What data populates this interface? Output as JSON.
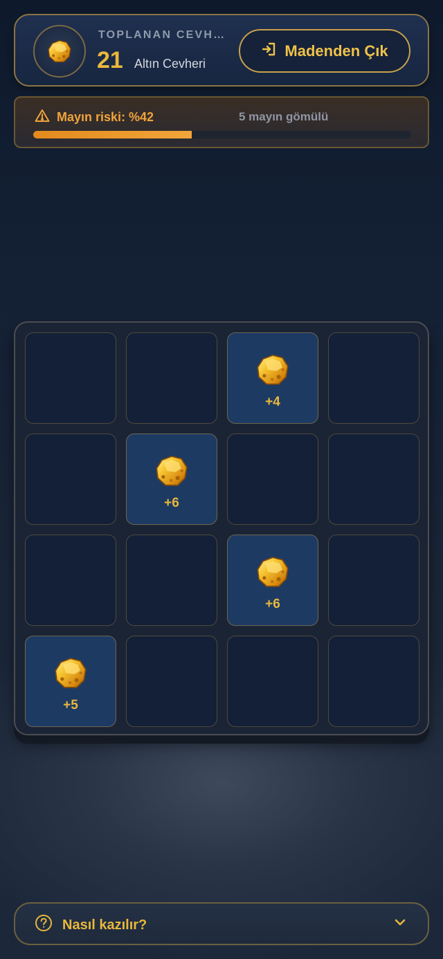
{
  "header": {
    "collected_label": "TOPLANAN CEVH…",
    "count": "21",
    "unit": "Altın Cevheri",
    "exit_label": "Madenden Çık"
  },
  "risk": {
    "label": "Mayın riski: %42",
    "percent": 42,
    "buried": "5 mayın gömülü"
  },
  "board": {
    "rows": 4,
    "cols": 4,
    "tiles": [
      {
        "state": "hidden",
        "gain": ""
      },
      {
        "state": "hidden",
        "gain": ""
      },
      {
        "state": "revealed",
        "gain": "+4"
      },
      {
        "state": "hidden",
        "gain": ""
      },
      {
        "state": "hidden",
        "gain": ""
      },
      {
        "state": "revealed",
        "gain": "+6"
      },
      {
        "state": "hidden",
        "gain": ""
      },
      {
        "state": "hidden",
        "gain": ""
      },
      {
        "state": "hidden",
        "gain": ""
      },
      {
        "state": "hidden",
        "gain": ""
      },
      {
        "state": "revealed",
        "gain": "+6"
      },
      {
        "state": "hidden",
        "gain": ""
      },
      {
        "state": "revealed",
        "gain": "+5"
      },
      {
        "state": "hidden",
        "gain": ""
      },
      {
        "state": "hidden",
        "gain": ""
      },
      {
        "state": "hidden",
        "gain": ""
      }
    ]
  },
  "help": {
    "label": "Nasıl kazılır?"
  },
  "colors": {
    "accent_gold": "#e8b83c",
    "risk_orange": "#f0a43a",
    "tile_hidden": "#132038",
    "tile_revealed": "#1d3a63"
  },
  "icons": {
    "ore": "gold-nugget-icon",
    "exit": "exit-door-icon",
    "warning": "warning-triangle-icon",
    "help": "question-circle-icon",
    "chevron": "chevron-down-icon"
  }
}
